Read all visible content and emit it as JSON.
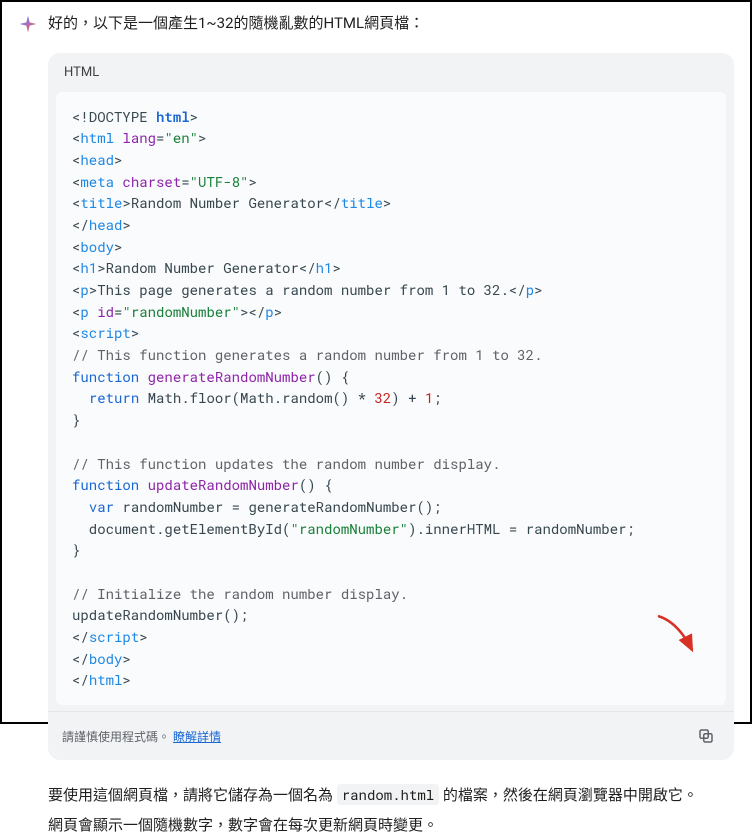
{
  "intro": "好的，以下是一個產生1~32的隨機亂數的HTML網頁檔：",
  "code": {
    "lang": "HTML",
    "tokens": [
      [
        "c-dt",
        "<!DOCTYPE "
      ],
      [
        "c-kw",
        "html"
      ],
      [
        "c-dt",
        ">"
      ],
      [
        "",
        "\n"
      ],
      [
        "c-plain",
        "<"
      ],
      [
        "c-tag",
        "html"
      ],
      [
        "c-plain",
        " "
      ],
      [
        "c-attr",
        "lang"
      ],
      [
        "c-plain",
        "="
      ],
      [
        "c-str",
        "\"en\""
      ],
      [
        "c-plain",
        ">"
      ],
      [
        "",
        "\n"
      ],
      [
        "c-plain",
        "<"
      ],
      [
        "c-tag",
        "head"
      ],
      [
        "c-plain",
        ">"
      ],
      [
        "",
        "\n"
      ],
      [
        "c-plain",
        "<"
      ],
      [
        "c-tag",
        "meta"
      ],
      [
        "c-plain",
        " "
      ],
      [
        "c-attr",
        "charset"
      ],
      [
        "c-plain",
        "="
      ],
      [
        "c-str",
        "\"UTF-8\""
      ],
      [
        "c-plain",
        ">"
      ],
      [
        "",
        "\n"
      ],
      [
        "c-plain",
        "<"
      ],
      [
        "c-tag",
        "title"
      ],
      [
        "c-plain",
        ">Random Number Generator</"
      ],
      [
        "c-tag",
        "title"
      ],
      [
        "c-plain",
        ">"
      ],
      [
        "",
        "\n"
      ],
      [
        "c-plain",
        "</"
      ],
      [
        "c-tag",
        "head"
      ],
      [
        "c-plain",
        ">"
      ],
      [
        "",
        "\n"
      ],
      [
        "c-plain",
        "<"
      ],
      [
        "c-tag",
        "body"
      ],
      [
        "c-plain",
        ">"
      ],
      [
        "",
        "\n"
      ],
      [
        "c-plain",
        "<"
      ],
      [
        "c-tag",
        "h1"
      ],
      [
        "c-plain",
        ">Random Number Generator</"
      ],
      [
        "c-tag",
        "h1"
      ],
      [
        "c-plain",
        ">"
      ],
      [
        "",
        "\n"
      ],
      [
        "c-plain",
        "<"
      ],
      [
        "c-tag",
        "p"
      ],
      [
        "c-plain",
        ">This page generates a random number from 1 to 32.</"
      ],
      [
        "c-tag",
        "p"
      ],
      [
        "c-plain",
        ">"
      ],
      [
        "",
        "\n"
      ],
      [
        "c-plain",
        "<"
      ],
      [
        "c-tag",
        "p"
      ],
      [
        "c-plain",
        " "
      ],
      [
        "c-attr",
        "id"
      ],
      [
        "c-plain",
        "="
      ],
      [
        "c-str",
        "\"randomNumber\""
      ],
      [
        "c-plain",
        "></"
      ],
      [
        "c-tag",
        "p"
      ],
      [
        "c-plain",
        ">"
      ],
      [
        "",
        "\n"
      ],
      [
        "c-plain",
        "<"
      ],
      [
        "c-tag",
        "script"
      ],
      [
        "c-plain",
        ">"
      ],
      [
        "",
        "\n"
      ],
      [
        "c-cmt",
        "// This function generates a random number from 1 to 32."
      ],
      [
        "",
        "\n"
      ],
      [
        "c-var",
        "function"
      ],
      [
        "c-plain",
        " "
      ],
      [
        "c-fn",
        "generateRandomNumber"
      ],
      [
        "c-plain",
        "() {"
      ],
      [
        "",
        "\n"
      ],
      [
        "c-plain",
        "  "
      ],
      [
        "c-var",
        "return"
      ],
      [
        "c-plain",
        " Math.floor(Math.random() * "
      ],
      [
        "c-num",
        "32"
      ],
      [
        "c-plain",
        ") + "
      ],
      [
        "c-num",
        "1"
      ],
      [
        "c-plain",
        ";"
      ],
      [
        "",
        "\n"
      ],
      [
        "c-plain",
        "}"
      ],
      [
        "",
        "\n"
      ],
      [
        "",
        "\n"
      ],
      [
        "c-cmt",
        "// This function updates the random number display."
      ],
      [
        "",
        "\n"
      ],
      [
        "c-var",
        "function"
      ],
      [
        "c-plain",
        " "
      ],
      [
        "c-fn",
        "updateRandomNumber"
      ],
      [
        "c-plain",
        "() {"
      ],
      [
        "",
        "\n"
      ],
      [
        "c-plain",
        "  "
      ],
      [
        "c-var",
        "var"
      ],
      [
        "c-plain",
        " randomNumber = generateRandomNumber();"
      ],
      [
        "",
        "\n"
      ],
      [
        "c-plain",
        "  document.getElementById("
      ],
      [
        "c-str",
        "\"randomNumber\""
      ],
      [
        "c-plain",
        ").innerHTML = randomNumber;"
      ],
      [
        "",
        "\n"
      ],
      [
        "c-plain",
        "}"
      ],
      [
        "",
        "\n"
      ],
      [
        "",
        "\n"
      ],
      [
        "c-cmt",
        "// Initialize the random number display."
      ],
      [
        "",
        "\n"
      ],
      [
        "c-plain",
        "updateRandomNumber();"
      ],
      [
        "",
        "\n"
      ],
      [
        "c-plain",
        "</"
      ],
      [
        "c-tag",
        "script"
      ],
      [
        "c-plain",
        ">"
      ],
      [
        "",
        "\n"
      ],
      [
        "c-plain",
        "</"
      ],
      [
        "c-tag",
        "body"
      ],
      [
        "c-plain",
        ">"
      ],
      [
        "",
        "\n"
      ],
      [
        "c-plain",
        "</"
      ],
      [
        "c-tag",
        "html"
      ],
      [
        "c-plain",
        ">"
      ]
    ],
    "warn_prefix": "請謹慎使用程式碼。",
    "warn_link": "瞭解詳情"
  },
  "outro": {
    "line1_a": "要使用這個網頁檔，請將它儲存為一個名為 ",
    "filename": "random.html",
    "line1_b": " 的檔案，然後在網頁瀏覽器中開啟它。",
    "line2": "網頁會顯示一個隨機數字，數字會在每次更新網頁時變更。"
  }
}
